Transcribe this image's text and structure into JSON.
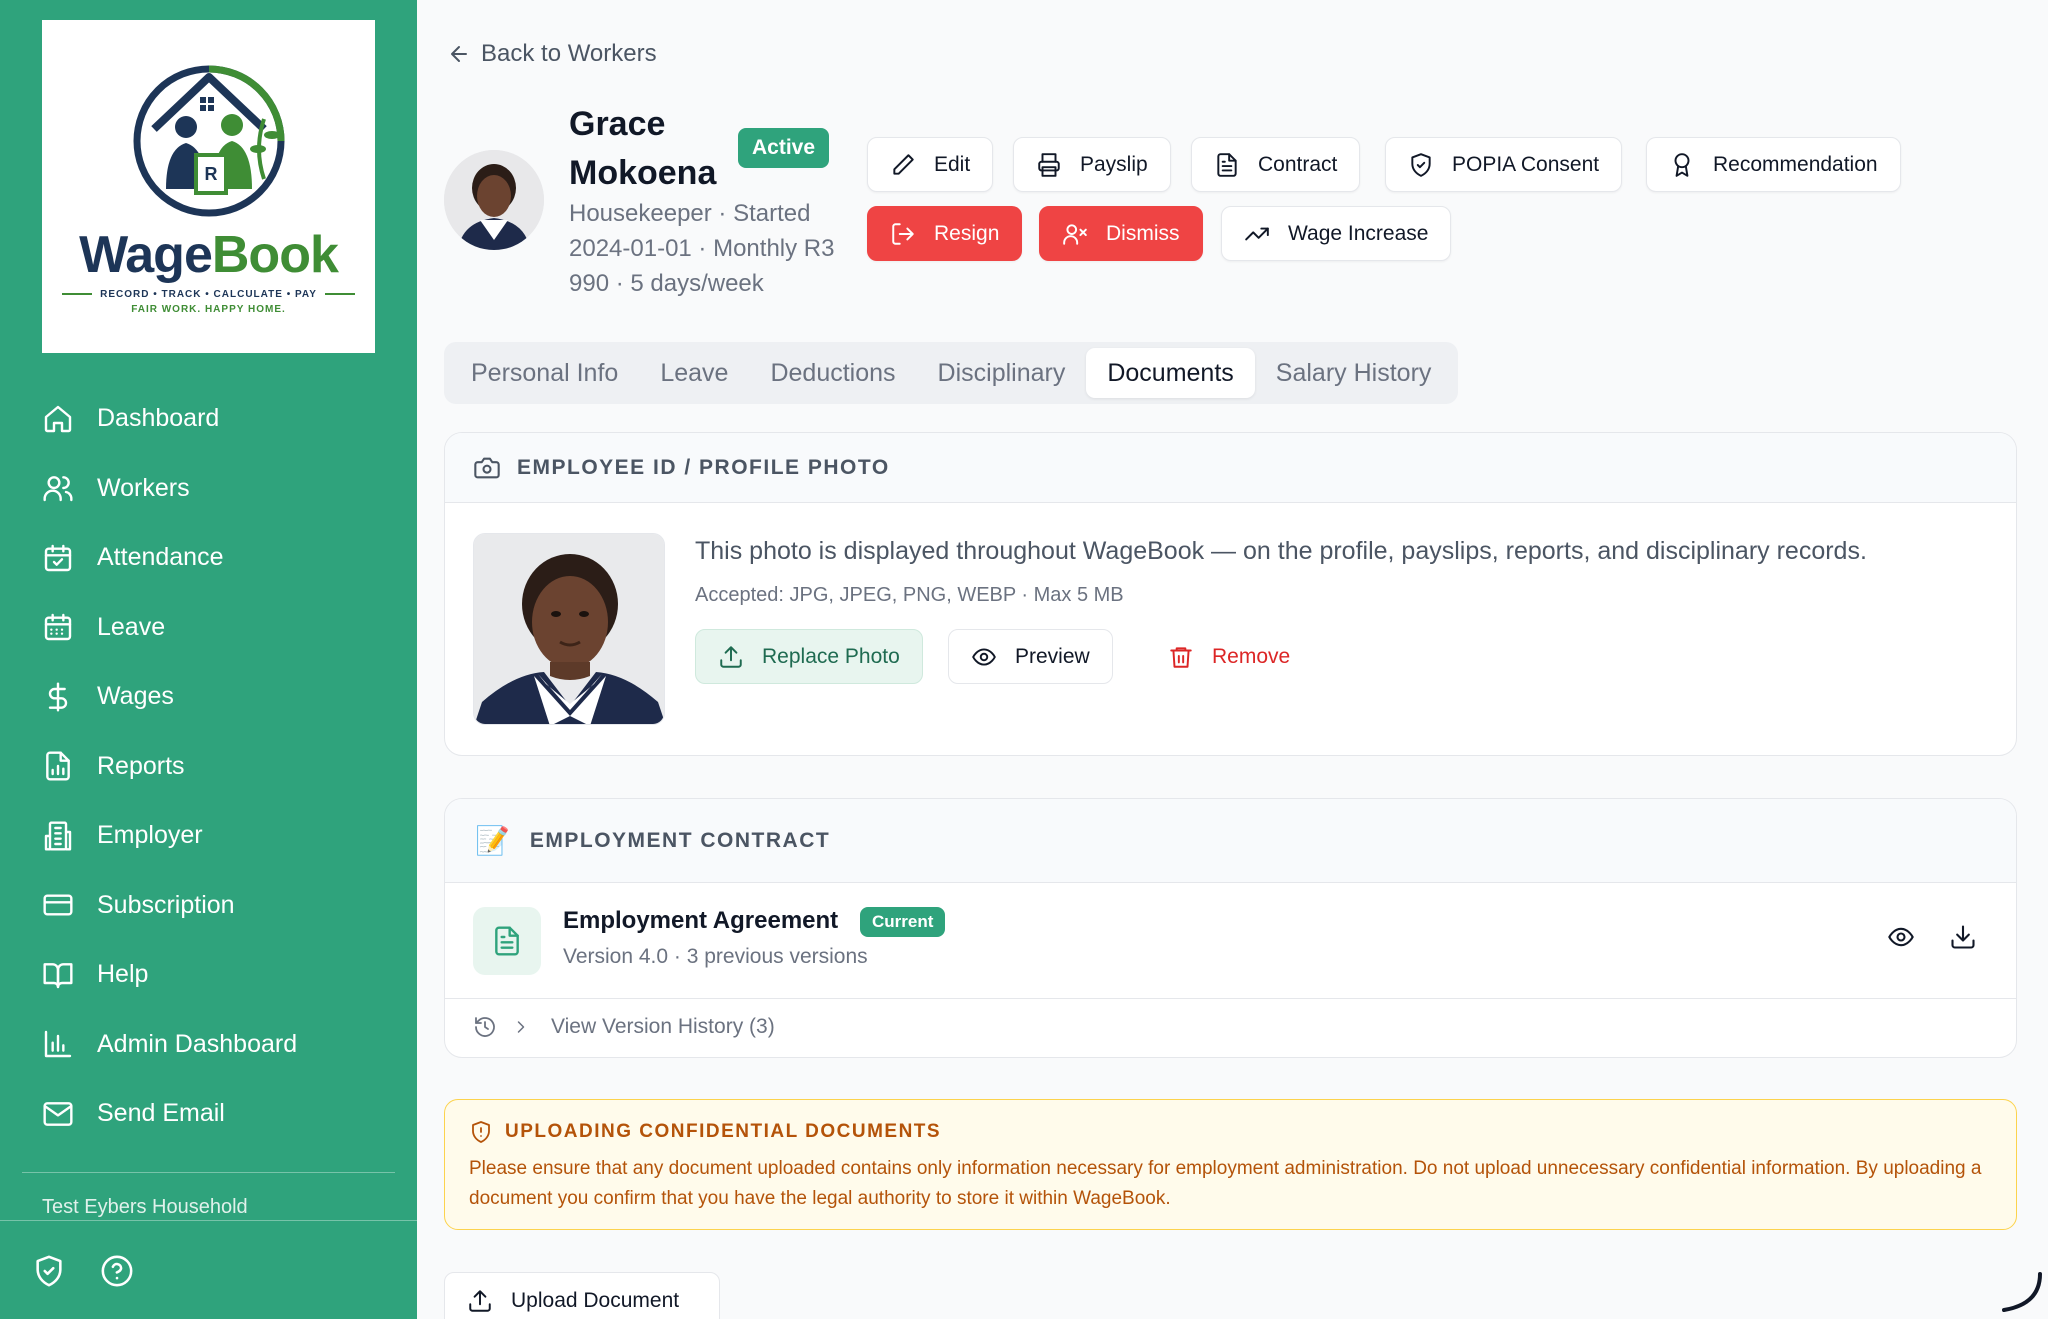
{
  "brand": {
    "name_part1": "Wage",
    "name_part2": "Book",
    "tagline": "RECORD • TRACK • CALCULATE • PAY",
    "slogan": "FAIR WORK. HAPPY HOME.",
    "logo_letter": "R",
    "primary_color": "#2fa37c",
    "navy": "#1d3557",
    "leaf_green": "#3f8d35"
  },
  "sidebar": {
    "items": [
      {
        "label": "Dashboard",
        "icon": "home-icon"
      },
      {
        "label": "Workers",
        "icon": "users-icon"
      },
      {
        "label": "Attendance",
        "icon": "calendar-check-icon"
      },
      {
        "label": "Leave",
        "icon": "calendar-icon"
      },
      {
        "label": "Wages",
        "icon": "dollar-icon"
      },
      {
        "label": "Reports",
        "icon": "report-icon"
      },
      {
        "label": "Employer",
        "icon": "building-icon"
      },
      {
        "label": "Subscription",
        "icon": "credit-card-icon"
      },
      {
        "label": "Help",
        "icon": "book-icon"
      },
      {
        "label": "Admin Dashboard",
        "icon": "bar-chart-icon"
      },
      {
        "label": "Send Email",
        "icon": "mail-icon"
      }
    ],
    "household": "Test Eybers Household"
  },
  "header": {
    "back_label": "Back to Workers",
    "worker_name": "Grace Mokoena",
    "status": "Active",
    "meta": "Housekeeper · Started 2024-01-01 · Monthly R3 990 · 5 days/week"
  },
  "actions": {
    "edit": "Edit",
    "payslip": "Payslip",
    "contract": "Contract",
    "popia": "POPIA Consent",
    "recommendation": "Recommendation",
    "resign": "Resign",
    "dismiss": "Dismiss",
    "wage_increase": "Wage Increase"
  },
  "tabs": [
    "Personal Info",
    "Leave",
    "Deductions",
    "Disciplinary",
    "Documents",
    "Salary History"
  ],
  "active_tab": "Documents",
  "photo_card": {
    "title": "EMPLOYEE ID / PROFILE PHOTO",
    "description": "This photo is displayed throughout WageBook — on the profile, payslips, reports, and disciplinary records.",
    "accepted": "Accepted: JPG, JPEG, PNG, WEBP · Max 5 MB",
    "replace_label": "Replace Photo",
    "preview_label": "Preview",
    "remove_label": "Remove"
  },
  "contract_card": {
    "title": "EMPLOYMENT CONTRACT",
    "title_icon": "📝",
    "doc_title": "Employment Agreement",
    "badge": "Current",
    "version": "Version 4.0 · 3 previous versions",
    "history_label": "View Version History (3)"
  },
  "warning": {
    "title": "UPLOADING CONFIDENTIAL DOCUMENTS",
    "body": "Please ensure that any document uploaded contains only information necessary for employment administration. Do not upload unnecessary confidential information. By uploading a document you confirm that you have the legal authority to store it within WageBook."
  },
  "upload_label": "Upload Document"
}
